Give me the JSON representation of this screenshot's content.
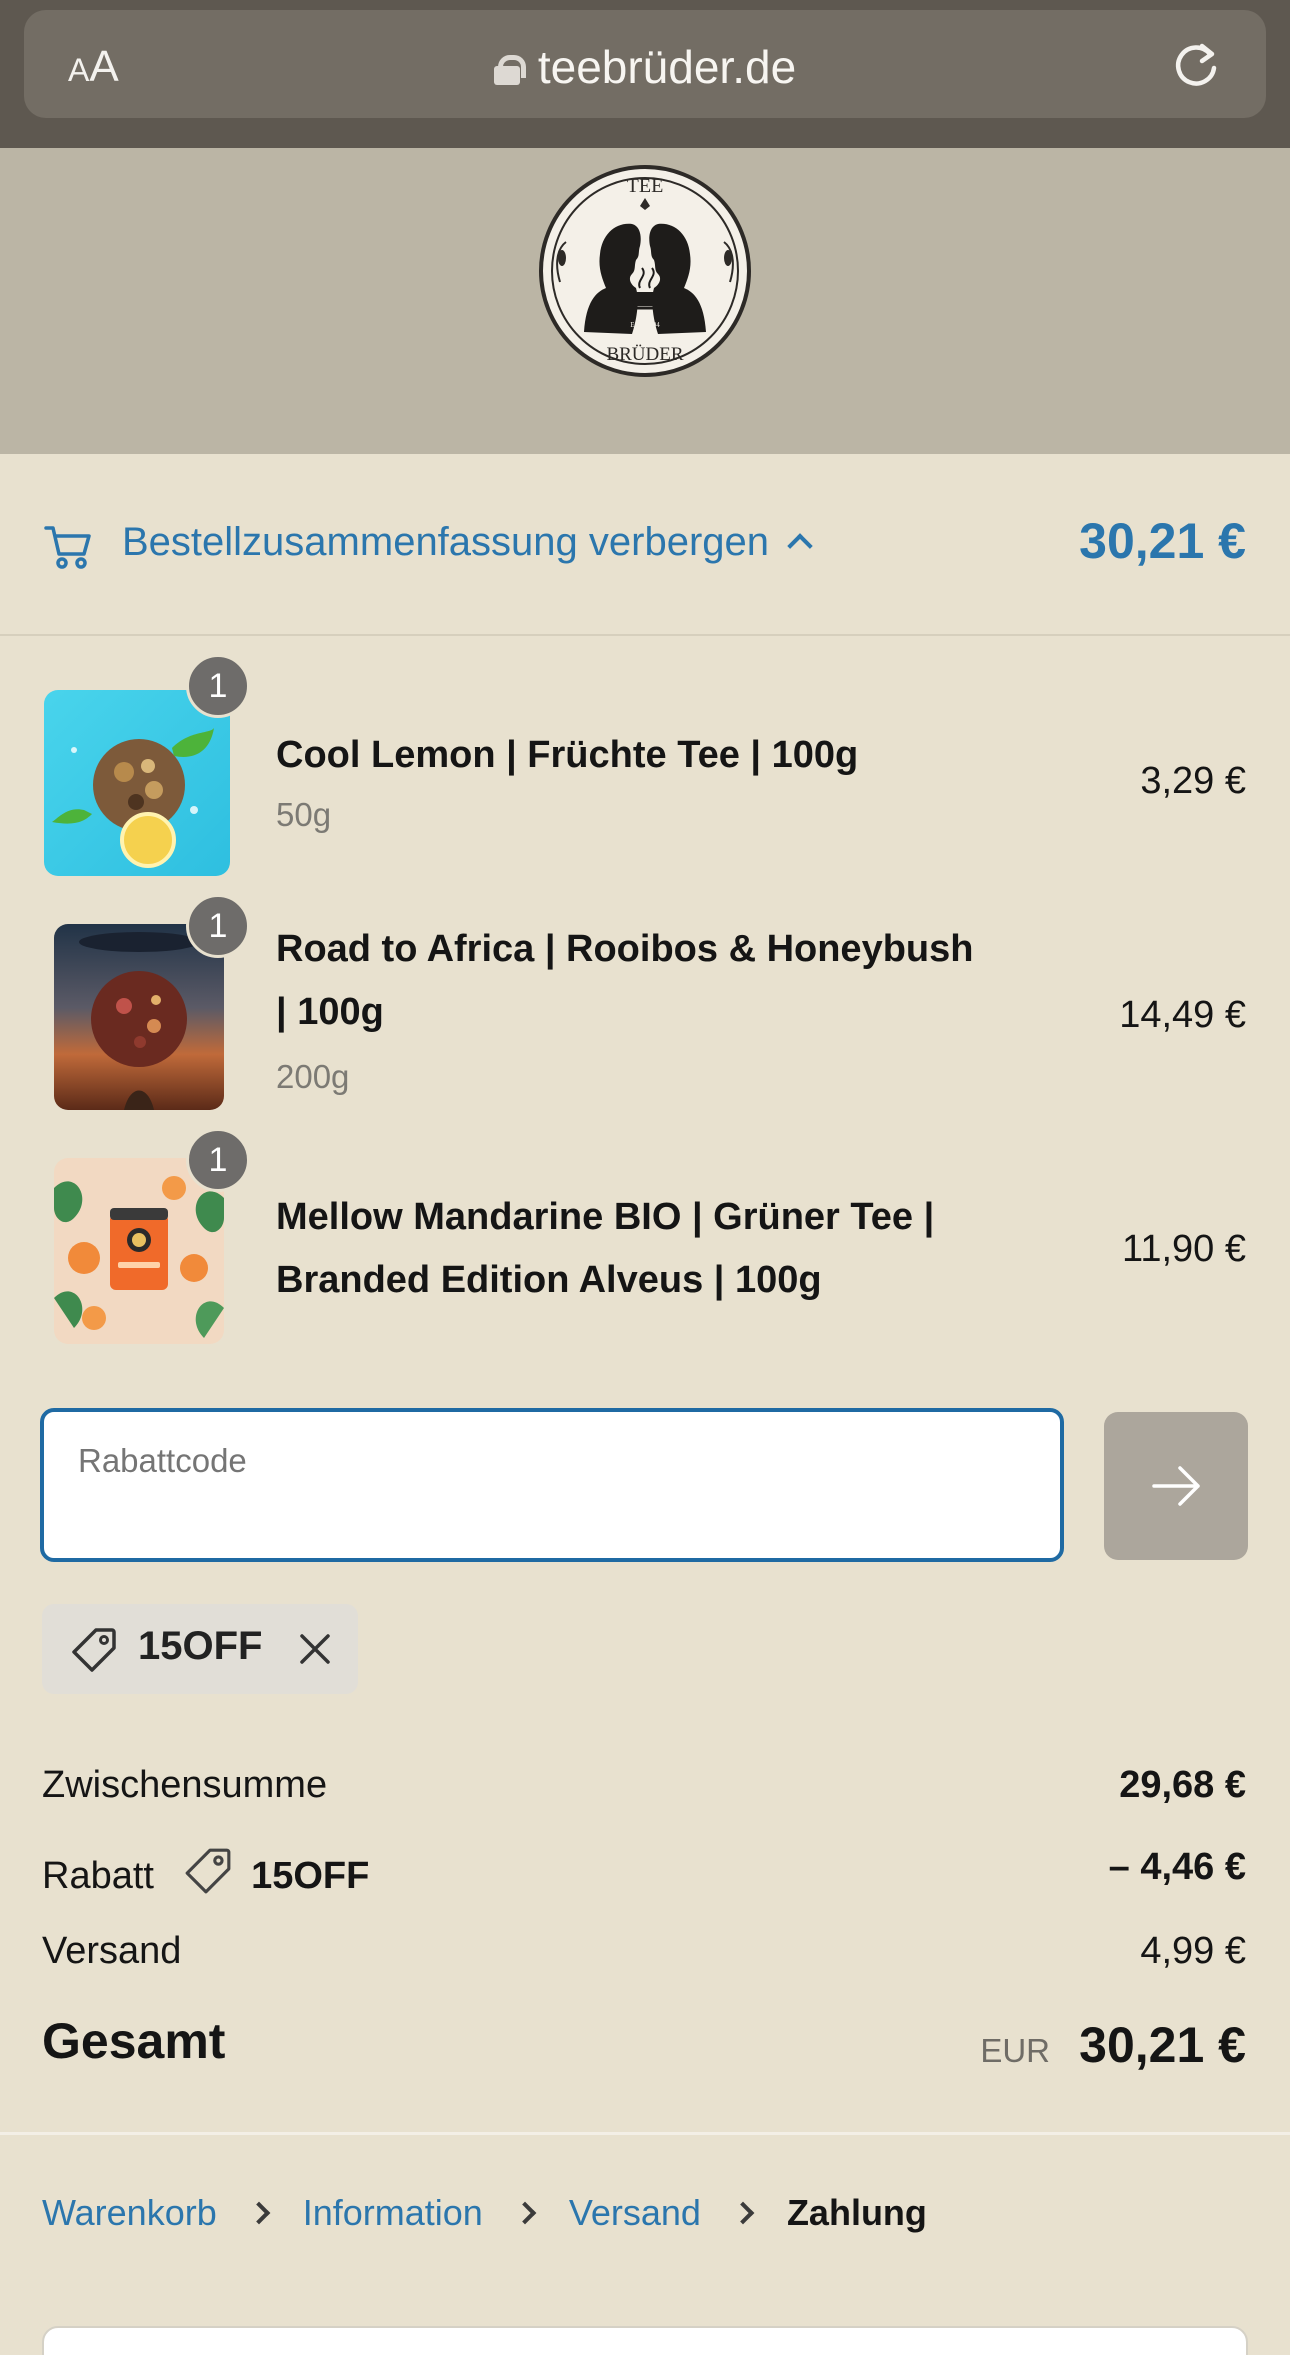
{
  "browser": {
    "aa_small": "A",
    "aa_large": "A",
    "url": "teebrüder.de"
  },
  "brand": {
    "logo_top": "TEE",
    "logo_bottom": "BRÜDER",
    "logo_est": "EST. 2004"
  },
  "summary": {
    "toggle_label": "Bestellzusammenfassung verbergen",
    "total": "30,21 €"
  },
  "items": [
    {
      "quantity": "1",
      "name_line1": "Cool Lemon | Früchte Tee | 100g",
      "name_line2": "",
      "variant": "50g",
      "price": "3,29 €"
    },
    {
      "quantity": "1",
      "name_line1": "Road to Africa | Rooibos & Honeybush",
      "name_line2": "| 100g",
      "variant": "200g",
      "price": "14,49 €"
    },
    {
      "quantity": "1",
      "name_line1": "Mellow Mandarine BIO | Grüner Tee |",
      "name_line2": "Branded Edition Alveus | 100g",
      "variant": "",
      "price": "11,90 €"
    }
  ],
  "discount": {
    "placeholder": "Rabattcode",
    "applied_code": "15OFF"
  },
  "totals": {
    "subtotal_label": "Zwischensumme",
    "subtotal_value": "29,68 €",
    "discount_label": "Rabatt",
    "discount_code": "15OFF",
    "discount_value": "– 4,46 €",
    "shipping_label": "Versand",
    "shipping_value": "4,99 €",
    "grand_label": "Gesamt",
    "currency": "EUR",
    "grand_value": "30,21 €"
  },
  "breadcrumb": {
    "items": [
      "Warenkorb",
      "Information",
      "Versand"
    ],
    "current": "Zahlung"
  },
  "colors": {
    "accent": "#2b76ad",
    "background": "#e8e1cf",
    "header": "#bbb5a5"
  }
}
